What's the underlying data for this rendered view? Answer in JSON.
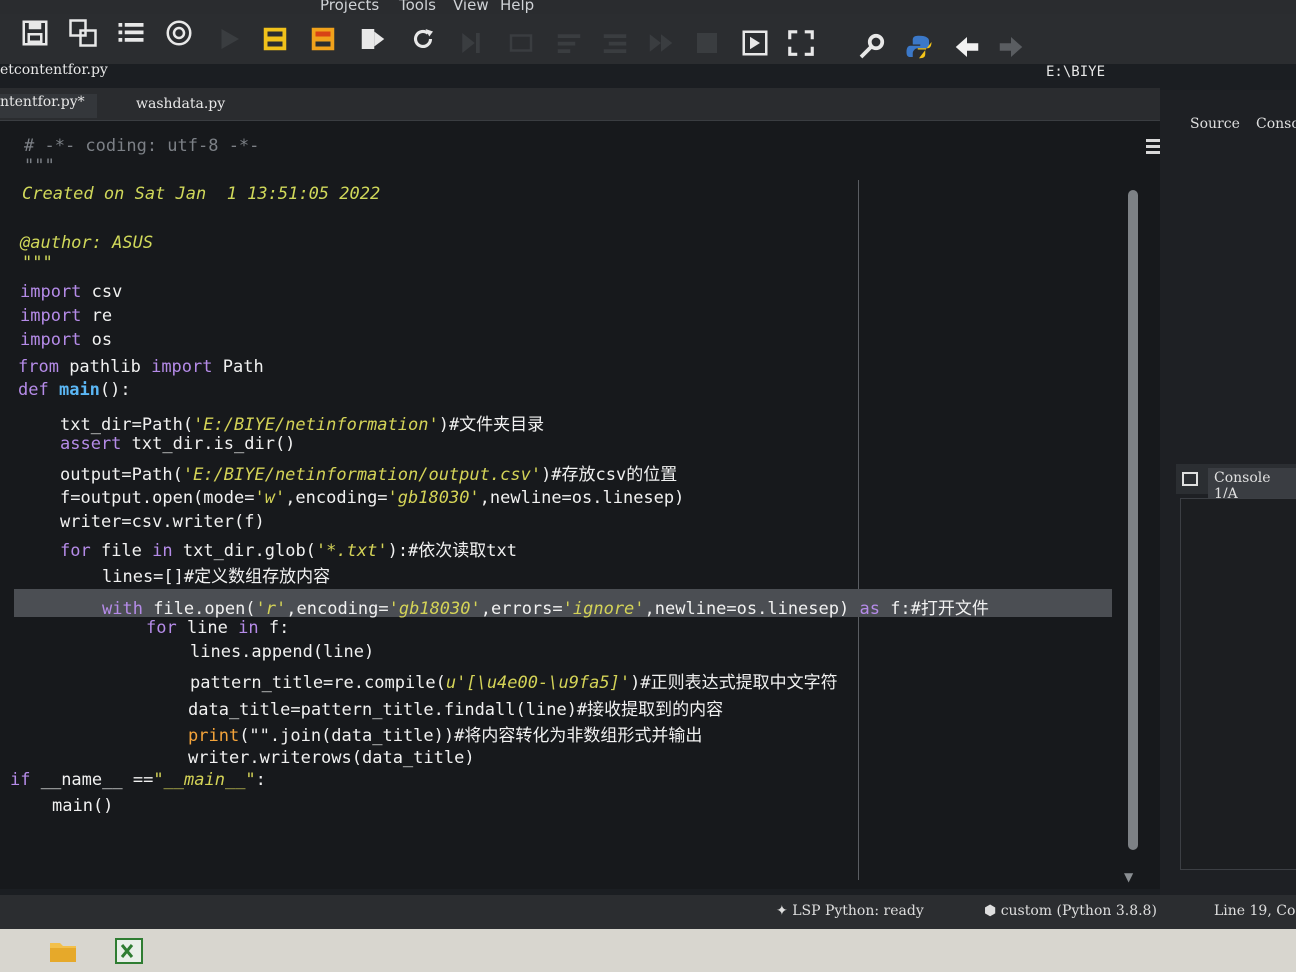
{
  "menu": [
    "Projects",
    "Tools",
    "View",
    "Help"
  ],
  "path": "E:\\BIYE",
  "file_list": [
    "etcontentfor.py"
  ],
  "tabs": [
    {
      "label": "ntentfor.py*",
      "active": true
    },
    {
      "label": "washdata.py",
      "active": false
    }
  ],
  "right_tabs": [
    "Source",
    "Conso"
  ],
  "console_tab": "Console 1/A",
  "toolbar_icons": [
    "save-icon",
    "save-all-icon",
    "list-icon",
    "at-icon",
    "run-icon",
    "run-cell-icon",
    "run-cell-advance-icon",
    "run-selection-icon",
    "rerun-icon",
    "debug-icon",
    "step-icon",
    "step-into-icon",
    "step-return-icon",
    "continue-icon",
    "stop-icon",
    "maximize-pane-icon",
    "fullscreen-icon",
    "wrench-icon",
    "python-icon",
    "back-arrow-icon",
    "forward-arrow-icon"
  ],
  "code_lines": [
    "# -*- coding: utf-8 -*-",
    "\"\"\"",
    "Created on Sat Jan  1 13:51:05 2022",
    "",
    "@author: ASUS",
    "\"\"\"",
    "import csv",
    "import re",
    "import os",
    "from pathlib import Path",
    "def main():",
    "    txt_dir=Path('E:/BIYE/netinformation')#文件夹目录",
    "    assert txt_dir.is_dir()",
    "    output=Path('E:/BIYE/netinformation/output.csv')#存放csv的位置",
    "    f=output.open(mode='w',encoding='gb18030',newline=os.linesep)",
    "    writer=csv.writer(f)",
    "    for file in txt_dir.glob('*.txt'):#依次读取txt",
    "        lines=[]#定义数组存放内容",
    "        with file.open('r',encoding='gb18030',errors='ignore',newline=os.linesep) as f:#打开文件",
    "            for line in f:",
    "                lines.append(line)",
    "                pattern_title=re.compile(u'[\\u4e00-\\u9fa5]')#正则表达式提取中文字符",
    "                data_title=pattern_title.findall(line)#接收提取到的内容",
    "                print(\"\".join(data_title))#将内容转化为非数组形式并输出",
    "                writer.writerows(data_title)",
    "if __name__ ==\"__main__\":",
    "    main()"
  ],
  "status": {
    "lsp": "LSP Python: ready",
    "env": "custom (Python 3.8.8)",
    "cursor": "Line 19, Co"
  }
}
